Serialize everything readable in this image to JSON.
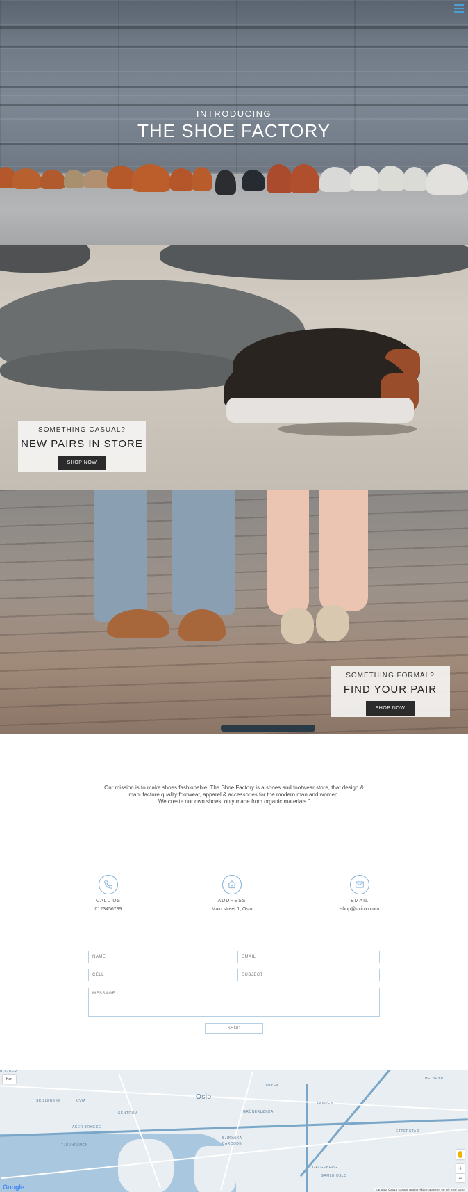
{
  "hero": {
    "intro": "INTRODUCING",
    "title": "THE SHOE FACTORY"
  },
  "casual": {
    "sub": "SOMETHING CASUAL?",
    "title": "NEW PAIRS IN STORE",
    "button": "SHOP NOW"
  },
  "formal": {
    "sub": "SOMETHING FORMAL?",
    "title": "FIND YOUR PAIR",
    "button": "SHOP NOW"
  },
  "mission": {
    "line1": "Our mission is to make shoes fashionable. The Shoe Factory is a shoes and footwear store, that design &",
    "line2": "manufacture quality footwear, apparel & accessories for the modern man and women.",
    "line3": "We create our own shoes, only made from organic materials.\""
  },
  "contact": {
    "call": {
      "label": "CALL US",
      "value": "0123456789"
    },
    "address": {
      "label": "ADDRESS",
      "value": "Main street 1, Oslo"
    },
    "email": {
      "label": "EMAIL",
      "value": "shop@miinto.com"
    }
  },
  "form": {
    "name": "NAME",
    "email": "EMAIL",
    "cell": "CELL",
    "subject": "SUBJECT",
    "message": "MESSAGE",
    "send": "SEND"
  },
  "map": {
    "kart": "Kart",
    "labels": [
      "Oslo",
      "SENTRUM",
      "GRÜNERLØKKA",
      "TØYEN",
      "GAMLE OSLO",
      "AKER BRYGGE",
      "TJUVHOLMEN",
      "ETTERSTAD",
      "HELSFYR",
      "KAMPEN",
      "GALGEBERG",
      "BJØRVIKA",
      "SKILLEBEKK",
      "UVIA",
      "BARCODE",
      "BOGNER"
    ],
    "google": "Google",
    "attribution": "Kartdata ©2016 Google   Brukervilkår   Rapporter en feil med kartet"
  }
}
